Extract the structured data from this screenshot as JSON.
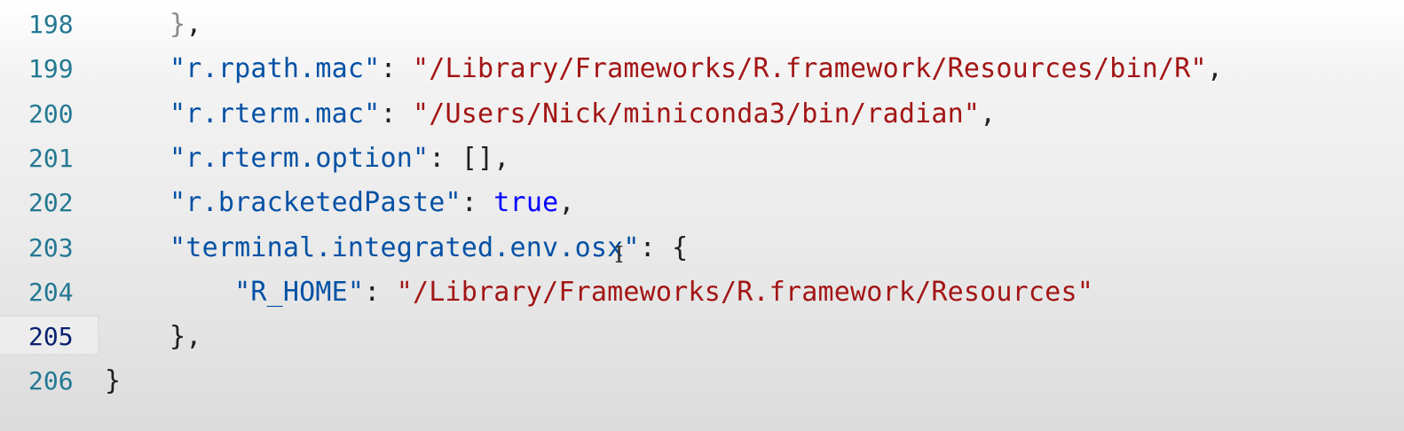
{
  "editor": {
    "lines": [
      {
        "number": "198",
        "parts": [
          {
            "t": "    ",
            "c": "pun"
          },
          {
            "t": "}",
            "c": "dim"
          },
          {
            "t": ",",
            "c": "pun"
          }
        ]
      },
      {
        "number": "199",
        "parts": [
          {
            "t": "    ",
            "c": "pun"
          },
          {
            "t": "\"r.rpath.mac\"",
            "c": "key"
          },
          {
            "t": ": ",
            "c": "pun"
          },
          {
            "t": "\"/Library/Frameworks/R.framework/Resources/bin/R\"",
            "c": "str"
          },
          {
            "t": ",",
            "c": "pun"
          }
        ]
      },
      {
        "number": "200",
        "parts": [
          {
            "t": "    ",
            "c": "pun"
          },
          {
            "t": "\"r.rterm.mac\"",
            "c": "key"
          },
          {
            "t": ": ",
            "c": "pun"
          },
          {
            "t": "\"/Users/Nick/miniconda3/bin/radian\"",
            "c": "str"
          },
          {
            "t": ",",
            "c": "pun"
          }
        ]
      },
      {
        "number": "201",
        "parts": [
          {
            "t": "    ",
            "c": "pun"
          },
          {
            "t": "\"r.rterm.option\"",
            "c": "key"
          },
          {
            "t": ": [],",
            "c": "pun"
          }
        ]
      },
      {
        "number": "202",
        "parts": [
          {
            "t": "    ",
            "c": "pun"
          },
          {
            "t": "\"r.bracketedPaste\"",
            "c": "key"
          },
          {
            "t": ": ",
            "c": "pun"
          },
          {
            "t": "true",
            "c": "kw"
          },
          {
            "t": ",",
            "c": "pun"
          }
        ]
      },
      {
        "number": "203",
        "parts": [
          {
            "t": "    ",
            "c": "pun"
          },
          {
            "t": "\"terminal.integrated.env.osx\"",
            "c": "key"
          },
          {
            "t": ": {",
            "c": "pun"
          }
        ]
      },
      {
        "number": "204",
        "parts": [
          {
            "t": "        ",
            "c": "pun"
          },
          {
            "t": "\"R_HOME\"",
            "c": "key"
          },
          {
            "t": ": ",
            "c": "pun"
          },
          {
            "t": "\"/Library/Frameworks/R.framework/Resources\"",
            "c": "str"
          }
        ]
      },
      {
        "number": "205",
        "current": true,
        "parts": [
          {
            "t": "    ",
            "c": "pun"
          },
          {
            "t": "},",
            "c": "pun"
          }
        ]
      },
      {
        "number": "206",
        "parts": [
          {
            "t": "}",
            "c": "pun"
          }
        ]
      }
    ]
  },
  "colors": {
    "line_number": "#237893",
    "line_number_active": "#0b216f",
    "json_key": "#0451a5",
    "json_string": "#a31515",
    "json_keyword": "#0000ff"
  },
  "icons": {
    "text_cursor": "i-beam-cursor-icon"
  }
}
